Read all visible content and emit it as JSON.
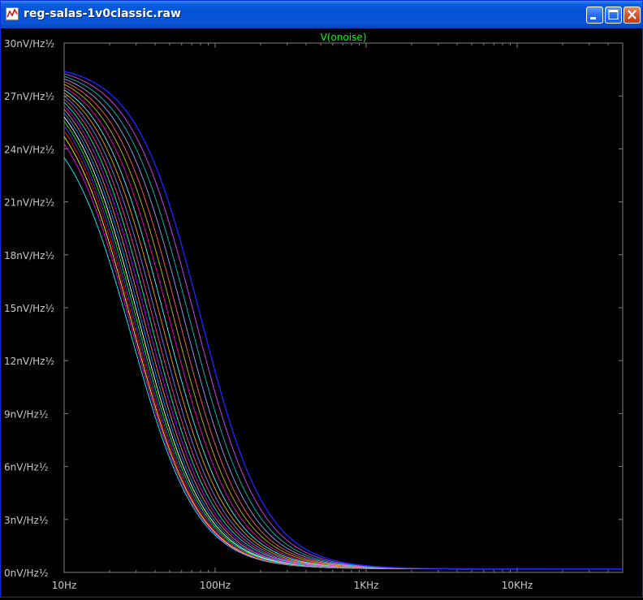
{
  "window": {
    "title": "reg-salas-1v0classic.raw",
    "buttons": [
      "minimize",
      "maximize",
      "close"
    ]
  },
  "chart_data": {
    "type": "line",
    "title": "V(onoise)",
    "x_scale": "log",
    "xlim": [
      10,
      50000
    ],
    "ylim": [
      0,
      30
    ],
    "y_ticks": [
      0,
      3,
      6,
      9,
      12,
      15,
      18,
      21,
      24,
      27,
      30
    ],
    "y_tick_labels": [
      "0nV/Hz½",
      "3nV/Hz½",
      "6nV/Hz½",
      "9nV/Hz½",
      "12nV/Hz½",
      "15nV/Hz½",
      "18nV/Hz½",
      "21nV/Hz½",
      "24nV/Hz½",
      "27nV/Hz½",
      "30nV/Hz½"
    ],
    "x_ticks": [
      10,
      100,
      1000,
      10000
    ],
    "x_tick_labels": [
      "10Hz",
      "100Hz",
      "1KHz",
      "10KHz"
    ],
    "curve_family": {
      "count": 22,
      "start_value_range": [
        23.5,
        28.4
      ],
      "corner_frequency_range_hz": [
        28,
        80
      ],
      "floor_value": 0.2,
      "colors": [
        "#00ffff",
        "#ff00ff",
        "#ffff00",
        "#ff0000",
        "#4040ff",
        "#00ff00",
        "#ffffff",
        "#00a0ff",
        "#ff8080",
        "#c000ff",
        "#00ffc0",
        "#ff40a0",
        "#8080ff",
        "#ffa000",
        "#40ffff",
        "#ff00c0",
        "#c0c000",
        "#ff6060",
        "#a0a0ff",
        "#00c0c0",
        "#e040ff",
        "#2020ff"
      ]
    },
    "colors": {
      "background": "#000000",
      "axis": "#808080",
      "text": "#c8c8c8",
      "title": "#00ff00"
    }
  }
}
